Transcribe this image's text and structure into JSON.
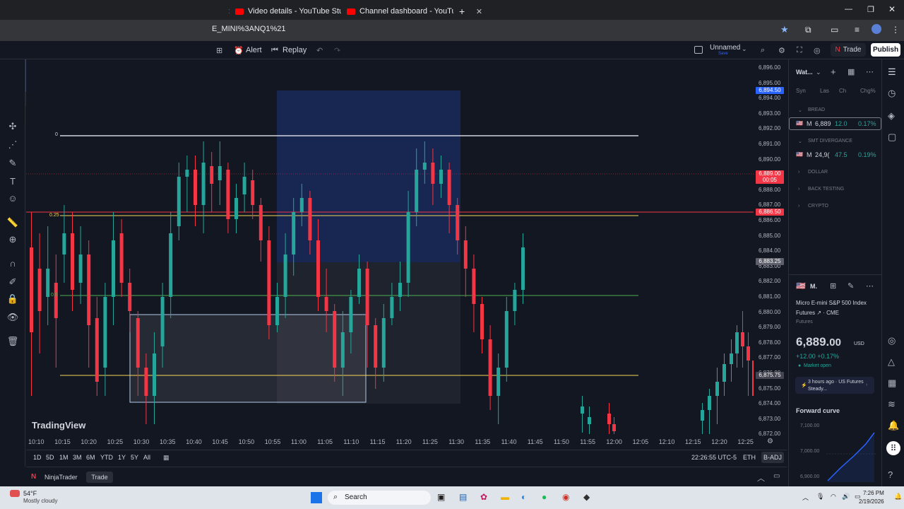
{
  "browser": {
    "tabs": [
      {
        "label": "Video details - YouTube Studio"
      },
      {
        "label": "Channel dashboard - YouTube"
      }
    ],
    "url_fragment": "E_MINI%3ANQ1%21"
  },
  "toolbar": {
    "alert_label": "Alert",
    "replay_label": "Replay",
    "layout_name": "Unnamed",
    "layout_status": "Save",
    "trade_label": "Trade",
    "publish_label": "Publish"
  },
  "chart": {
    "watermark": "TradingView",
    "level_labels": {
      "zero": "0",
      "quarter": "0.25",
      "half": "0.5"
    },
    "price_ticks": [
      "6,896.00",
      "6,895.00",
      "6,894.00",
      "6,893.00",
      "6,892.00",
      "6,891.00",
      "6,890.00",
      "6,889.00",
      "6,888.00",
      "6,887.00",
      "6,886.00",
      "6,885.00",
      "6,884.00",
      "6,883.00",
      "6,882.00",
      "6,881.00",
      "6,880.00",
      "6,879.00",
      "6,878.00",
      "6,877.00",
      "6,876.00",
      "6,875.00",
      "6,874.00",
      "6,873.00",
      "6,872.00"
    ],
    "price_tags": {
      "blue": "6,894.50",
      "current": "6,889.00",
      "countdown": "00:05",
      "red_line": "6,886.50",
      "gray": "6,883.25",
      "lower": "6,875.75"
    },
    "time_ticks": [
      "10:10",
      "10:15",
      "10:20",
      "10:25",
      "10:30",
      "10:35",
      "10:40",
      "10:45",
      "10:50",
      "10:55",
      "11:00",
      "11:05",
      "11:10",
      "11:15",
      "11:20",
      "11:25",
      "11:30",
      "11:35",
      "11:40",
      "11:45",
      "11:50",
      "11:55",
      "12:00",
      "12:05",
      "12:10",
      "12:15",
      "12:20",
      "12:25"
    ],
    "ranges": [
      "1D",
      "5D",
      "1M",
      "3M",
      "6M",
      "YTD",
      "1Y",
      "5Y",
      "All"
    ],
    "clock": "22:26:55 UTC-5",
    "session": "ETH",
    "adj": "B-ADJ",
    "broker_label": "NinjaTrader",
    "broker_trade": "Trade"
  },
  "watchlist": {
    "title": "Wat...",
    "columns": [
      "Syn",
      "Las",
      "Ch",
      "Chg%"
    ],
    "sections": [
      {
        "name": "BREAD",
        "rows": [
          {
            "symbol": "M",
            "last": "6,889",
            "chg": "12.0",
            "chgp": "0.17%"
          }
        ]
      },
      {
        "name": "SMT DIVERGANCE",
        "rows": [
          {
            "symbol": "M",
            "last": "24,9(",
            "chg": "47.5",
            "chgp": "0.19%"
          }
        ]
      },
      {
        "name": "DOLLAR",
        "rows": []
      },
      {
        "name": "BACK TESTING",
        "rows": []
      },
      {
        "name": "CRYPTO",
        "rows": []
      }
    ]
  },
  "details": {
    "symbol_short": "M.",
    "name": "Micro E-mini S&P 500 Index",
    "exchange": "Futures ↗ · CME",
    "kind": "Futures",
    "price_main": "6,889.",
    "price_dec": "00",
    "currency": "USD",
    "change": "+12.00 +0.17%",
    "market_status": "Market open",
    "news": "3 hours ago · US Futures Steady...",
    "curve_title": "Forward curve",
    "curve_ticks": [
      "7,100.00",
      "7,000.00",
      "6,900.00"
    ]
  },
  "taskbar": {
    "weather_temp": "54°F",
    "weather_desc": "Mostly cloudy",
    "search_placeholder": "Search",
    "time": "7:26 PM",
    "date": "2/19/2026"
  },
  "chart_data": {
    "type": "candlestick",
    "x": [
      "10:10",
      "10:15",
      "10:20",
      "10:25",
      "10:30",
      "10:35",
      "10:40",
      "10:45",
      "10:50",
      "10:55",
      "11:00",
      "11:05",
      "11:10",
      "11:15",
      "11:20",
      "11:25",
      "11:30",
      "11:35",
      "11:40",
      "11:45",
      "11:50",
      "11:55",
      "12:00",
      "12:05",
      "12:10",
      "12:15",
      "12:20",
      "12:25"
    ],
    "ylim": [
      6872,
      6896.5
    ],
    "levels": [
      {
        "label": "0",
        "value": 6891.8,
        "color": "#ffffff"
      },
      {
        "label": "0.25",
        "value": 6886.5,
        "color": "#f7d55a"
      },
      {
        "label": "0.5",
        "value": 6881.1,
        "color": "#4caf50"
      },
      {
        "value": 6875.8,
        "color": "#f7d55a"
      }
    ]
  }
}
